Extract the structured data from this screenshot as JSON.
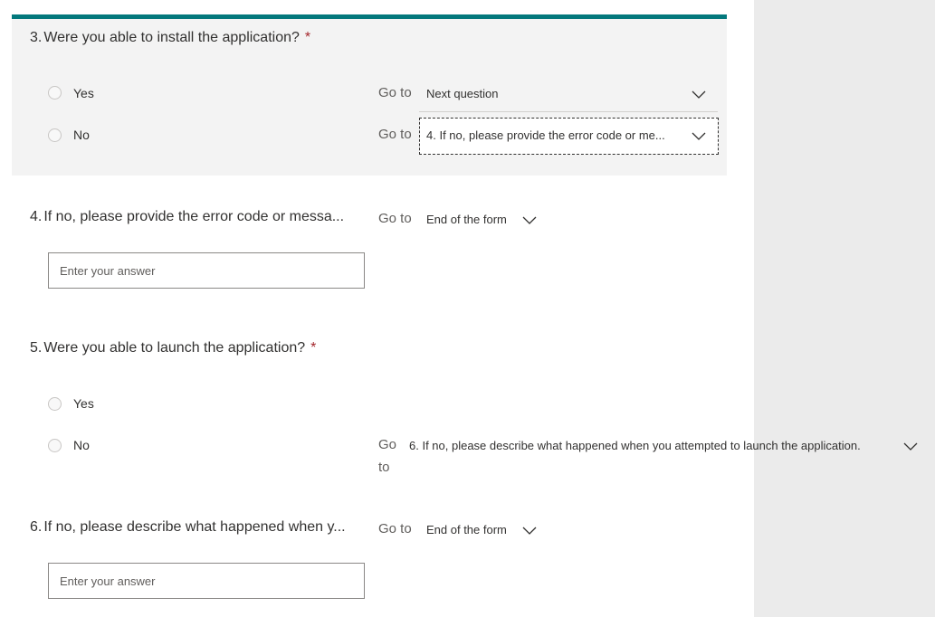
{
  "goto_label": "Go to",
  "questions": [
    {
      "number": "3.",
      "title": "Were you able to install the application?",
      "required_mark": "*",
      "options": [
        {
          "label": "Yes",
          "goto": "Next question"
        },
        {
          "label": "No",
          "goto": "4. If no, please provide the error code or me..."
        }
      ]
    },
    {
      "number": "4.",
      "title": "If no, please provide the error code or messa...",
      "goto": "End of the form",
      "answer_placeholder": "Enter your answer"
    },
    {
      "number": "5.",
      "title": "Were you able to launch the application?",
      "required_mark": "*",
      "options": [
        {
          "label": "Yes"
        },
        {
          "label": "No",
          "goto_line1": "Go",
          "goto_line2": "to",
          "goto": "6. If no, please describe what happened when you attempted to launch the application."
        }
      ]
    },
    {
      "number": "6.",
      "title": "If no, please describe what happened when y...",
      "goto": "End of the form",
      "answer_placeholder": "Enter your answer"
    }
  ],
  "colors": {
    "accent_bar": "#03787c",
    "required": "#a4262c",
    "active_background": "#f3f3f3",
    "gutter_background": "#ebebeb"
  }
}
